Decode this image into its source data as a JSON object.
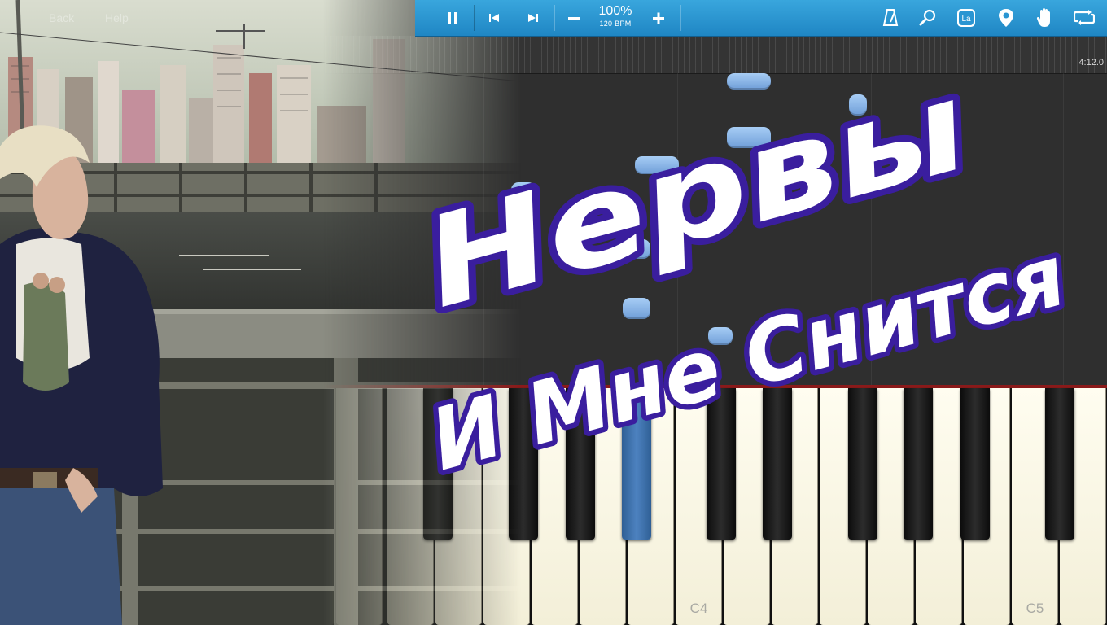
{
  "menu": {
    "back_label": "Back",
    "help_label": "Help"
  },
  "toolbar": {
    "tempo_percent": "100%",
    "tempo_bpm": "120 BPM",
    "icons": [
      "pause-icon",
      "skip-back-icon",
      "skip-forward-icon",
      "minus-icon",
      "plus-icon",
      "metronome-icon",
      "search-icon",
      "la-icon",
      "location-pin-icon",
      "hand-icon",
      "loop-icon"
    ],
    "la_label": "La",
    "accent_color": "#2a95d2"
  },
  "timeline": {
    "time": "4:12.0"
  },
  "keyboard": {
    "labels": {
      "c4": "C4",
      "c5": "C5"
    },
    "active_key_color": "#4a7fbd"
  },
  "title": {
    "line1": "Нервы",
    "line2": "И Мне Снится",
    "outline_color": "#3a1e9e"
  },
  "photo": {
    "description_colors": {
      "sky": "#cfd6c6",
      "jacket": "#1f2240"
    }
  }
}
